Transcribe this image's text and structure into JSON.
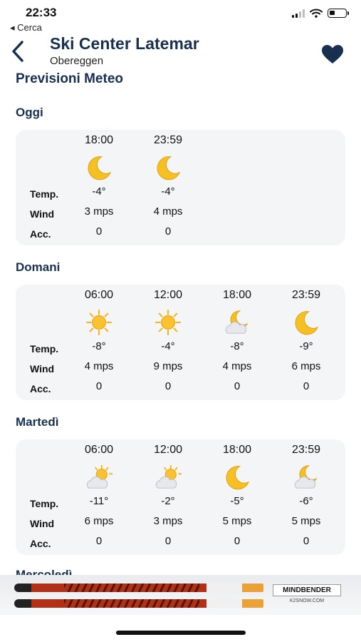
{
  "status_bar": {
    "time": "22:33"
  },
  "back_app": "◂ Cerca",
  "header": {
    "title": "Ski Center Latemar",
    "subtitle": "Obereggen"
  },
  "section_title": "Previsioni Meteo",
  "row_labels": {
    "temp": "Temp.",
    "wind": "Wind",
    "acc": "Acc."
  },
  "days": [
    {
      "title": "Oggi",
      "slots": [
        {
          "hour": "18:00",
          "icon": "moon-icon",
          "temp": "-4°",
          "wind": "3 mps",
          "acc": "0"
        },
        {
          "hour": "23:59",
          "icon": "moon-icon",
          "temp": "-4°",
          "wind": "4 mps",
          "acc": "0"
        }
      ]
    },
    {
      "title": "Domani",
      "slots": [
        {
          "hour": "06:00",
          "icon": "sun-icon",
          "temp": "-8°",
          "wind": "4 mps",
          "acc": "0"
        },
        {
          "hour": "12:00",
          "icon": "sun-icon",
          "temp": "-4°",
          "wind": "9 mps",
          "acc": "0"
        },
        {
          "hour": "18:00",
          "icon": "moon-cloud-icon",
          "temp": "-8°",
          "wind": "4 mps",
          "acc": "0"
        },
        {
          "hour": "23:59",
          "icon": "moon-icon",
          "temp": "-9°",
          "wind": "6 mps",
          "acc": "0"
        }
      ]
    },
    {
      "title": "Martedì",
      "slots": [
        {
          "hour": "06:00",
          "icon": "sun-cloud-icon",
          "temp": "-11°",
          "wind": "6 mps",
          "acc": "0"
        },
        {
          "hour": "12:00",
          "icon": "sun-cloud-icon",
          "temp": "-2°",
          "wind": "3 mps",
          "acc": "0"
        },
        {
          "hour": "18:00",
          "icon": "moon-icon",
          "temp": "-5°",
          "wind": "5 mps",
          "acc": "0"
        },
        {
          "hour": "23:59",
          "icon": "moon-cloud-icon",
          "temp": "-6°",
          "wind": "5 mps",
          "acc": "0"
        }
      ]
    }
  ],
  "next_day_partial": "Mercoledì",
  "ad": {
    "brand": "MINDBENDER",
    "sub": "K2SNOW.COM"
  },
  "colors": {
    "title": "#17304f",
    "card": "#f4f5f7",
    "sun": "#f7b51c",
    "moon": "#f5c023"
  }
}
